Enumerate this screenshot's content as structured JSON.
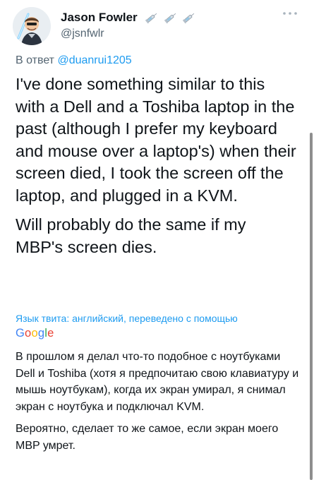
{
  "author": {
    "display_name": "Jason Fowler",
    "handle": "@jsnfwlr",
    "badge_icons": [
      "syringe-icon",
      "syringe-icon",
      "syringe-icon"
    ]
  },
  "reply": {
    "prefix": "В ответ",
    "to_handle": "@duanrui1205"
  },
  "tweet": {
    "paragraphs": [
      "I've done something similar to this with a Dell and a Toshiba laptop in the past (although I prefer my keyboard and mouse over a laptop's) when their screen died, I took the screen off the laptop, and plugged in a KVM.",
      "Will probably do the same if my MBP's screen dies."
    ]
  },
  "translation": {
    "note": "Язык твита: английский, переведено с помощью",
    "provider_letters": [
      "G",
      "o",
      "o",
      "g",
      "l",
      "e"
    ],
    "provider_colors": [
      "#4285F4",
      "#EA4335",
      "#FBBC05",
      "#4285F4",
      "#34A853",
      "#EA4335"
    ],
    "paragraphs": [
      "В прошлом я делал что-то подобное с ноутбуками Dell и Toshiba (хотя я предпочитаю свою клавиатуру и мышь ноутбукам), когда их экран умирал, я снимал экран с ноутбука и подключал KVM.",
      "Вероятно, сделает то же самое, если экран моего MBP умрет."
    ]
  },
  "colors": {
    "text": "#0f1419",
    "secondary": "#536471",
    "link": "#1d9bf0"
  },
  "icons": {
    "more": "more-options-icon",
    "avatar": "avatar"
  }
}
